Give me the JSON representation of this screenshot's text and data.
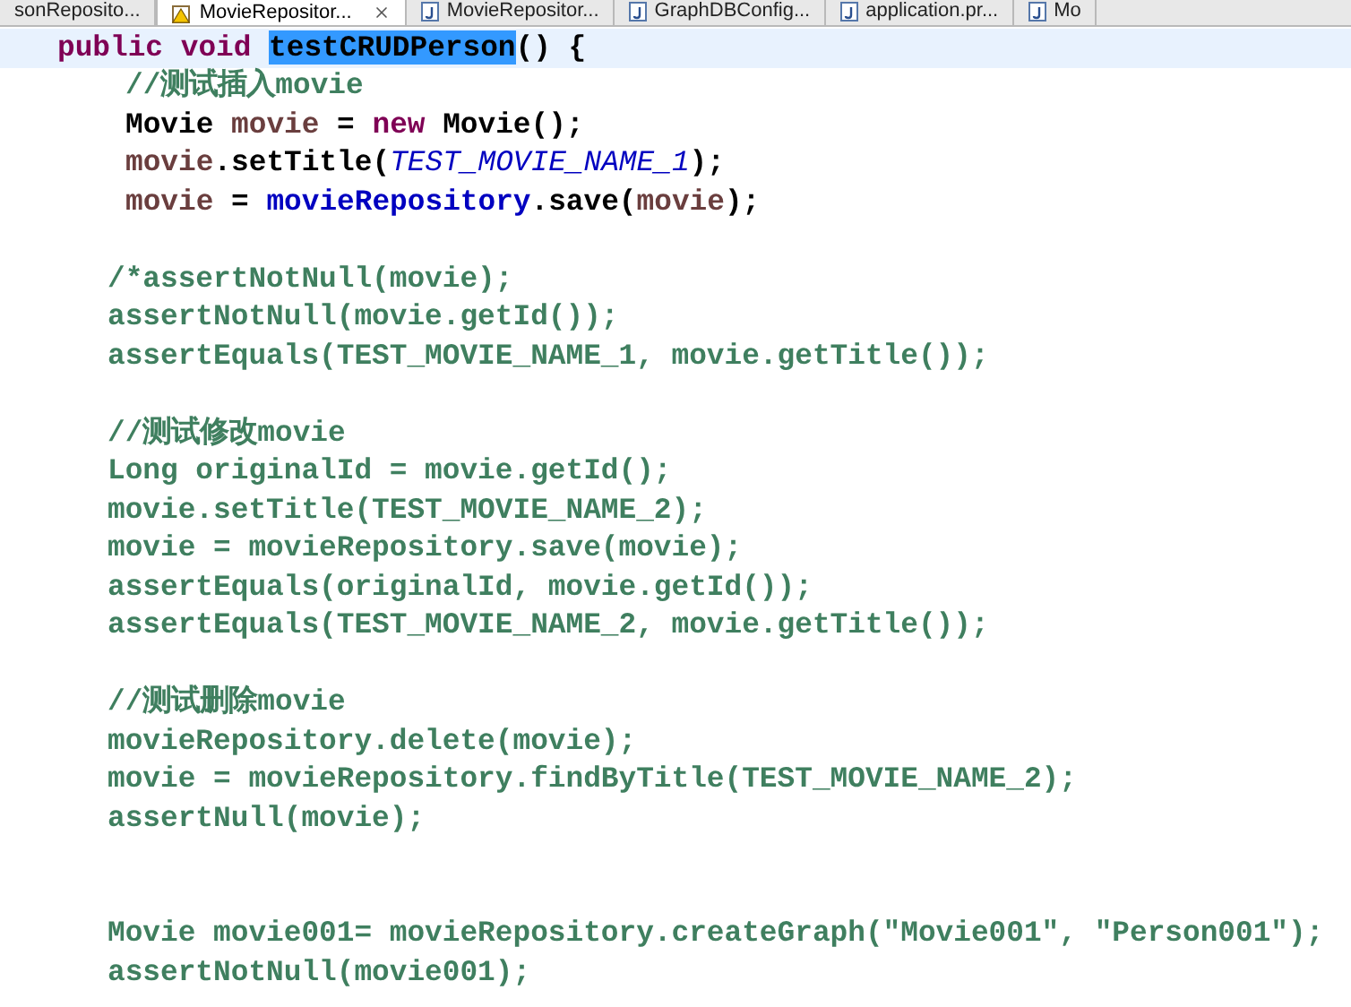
{
  "tabs": [
    {
      "label": "sonReposito...",
      "selected": false,
      "kind": "partial"
    },
    {
      "label": "MovieRepositor...",
      "selected": true,
      "kind": "warning"
    },
    {
      "label": "MovieRepositor...",
      "selected": false,
      "kind": "java"
    },
    {
      "label": "GraphDBConfig...",
      "selected": false,
      "kind": "java"
    },
    {
      "label": "application.pr...",
      "selected": false,
      "kind": "java"
    },
    {
      "label": "Mo",
      "selected": false,
      "kind": "java"
    }
  ],
  "editor": {
    "lines": [
      {
        "kind": "signature",
        "current": true,
        "tokens": [
          {
            "text": "public void ",
            "kind": "keyword"
          },
          {
            "text": "testCRUDPerson",
            "kind": "selection"
          },
          {
            "text": "() {",
            "kind": "plain"
          }
        ]
      },
      {
        "kind": "inner",
        "current": false,
        "tokens": [
          {
            "text": "//测试插入movie",
            "kind": "comment"
          }
        ]
      },
      {
        "kind": "inner",
        "current": false,
        "tokens": [
          {
            "text": "Movie ",
            "kind": "plain"
          },
          {
            "text": "movie",
            "kind": "local"
          },
          {
            "text": " = ",
            "kind": "plain"
          },
          {
            "text": "new",
            "kind": "keyword"
          },
          {
            "text": " Movie();",
            "kind": "plain"
          }
        ]
      },
      {
        "kind": "inner",
        "current": false,
        "tokens": [
          {
            "text": "movie",
            "kind": "local"
          },
          {
            "text": ".setTitle(",
            "kind": "plain"
          },
          {
            "text": "TEST_MOVIE_NAME_1",
            "kind": "constant"
          },
          {
            "text": ");",
            "kind": "plain"
          }
        ]
      },
      {
        "kind": "inner",
        "current": false,
        "tokens": [
          {
            "text": "movie",
            "kind": "local"
          },
          {
            "text": " = ",
            "kind": "plain"
          },
          {
            "text": "movieRepository",
            "kind": "field"
          },
          {
            "text": ".save(",
            "kind": "plain"
          },
          {
            "text": "movie",
            "kind": "local"
          },
          {
            "text": ");",
            "kind": "plain"
          }
        ]
      },
      {
        "kind": "blank",
        "current": false
      },
      {
        "kind": "body",
        "current": false,
        "tokens": [
          {
            "text": "/*assertNotNull(movie);",
            "kind": "comment"
          }
        ]
      },
      {
        "kind": "body",
        "current": false,
        "tokens": [
          {
            "text": "assertNotNull(movie.getId());",
            "kind": "comment"
          }
        ]
      },
      {
        "kind": "body",
        "current": false,
        "tokens": [
          {
            "text": "assertEquals(TEST_MOVIE_NAME_1, movie.getTitle());",
            "kind": "comment"
          }
        ]
      },
      {
        "kind": "blank",
        "current": false
      },
      {
        "kind": "body",
        "current": false,
        "tokens": [
          {
            "text": "//测试修改movie",
            "kind": "comment"
          }
        ]
      },
      {
        "kind": "body",
        "current": false,
        "tokens": [
          {
            "text": "Long originalId = movie.getId();",
            "kind": "comment"
          }
        ]
      },
      {
        "kind": "body",
        "current": false,
        "tokens": [
          {
            "text": "movie.setTitle(TEST_MOVIE_NAME_2);",
            "kind": "comment"
          }
        ]
      },
      {
        "kind": "body",
        "current": false,
        "tokens": [
          {
            "text": "movie = movieRepository.save(movie);",
            "kind": "comment"
          }
        ]
      },
      {
        "kind": "body",
        "current": false,
        "tokens": [
          {
            "text": "assertEquals(originalId, movie.getId());",
            "kind": "comment"
          }
        ]
      },
      {
        "kind": "body",
        "current": false,
        "tokens": [
          {
            "text": "assertEquals(TEST_MOVIE_NAME_2, movie.getTitle());",
            "kind": "comment"
          }
        ]
      },
      {
        "kind": "blank",
        "current": false
      },
      {
        "kind": "body",
        "current": false,
        "tokens": [
          {
            "text": "//测试删除movie",
            "kind": "comment"
          }
        ]
      },
      {
        "kind": "body",
        "current": false,
        "tokens": [
          {
            "text": "movieRepository.delete(movie);",
            "kind": "comment"
          }
        ]
      },
      {
        "kind": "body",
        "current": false,
        "tokens": [
          {
            "text": "movie = movieRepository.findByTitle(TEST_MOVIE_NAME_2);",
            "kind": "comment"
          }
        ]
      },
      {
        "kind": "body",
        "current": false,
        "tokens": [
          {
            "text": "assertNull(movie);",
            "kind": "comment"
          }
        ]
      },
      {
        "kind": "blank",
        "current": false
      },
      {
        "kind": "blank",
        "current": false
      },
      {
        "kind": "body",
        "current": false,
        "tokens": [
          {
            "text": "Movie movie001= movieRepository.createGraph(\"Movie001\", \"Person001\");",
            "kind": "comment"
          }
        ]
      },
      {
        "kind": "body",
        "current": false,
        "tokens": [
          {
            "text": "assertNotNull(movie001);",
            "kind": "comment"
          }
        ]
      }
    ]
  }
}
